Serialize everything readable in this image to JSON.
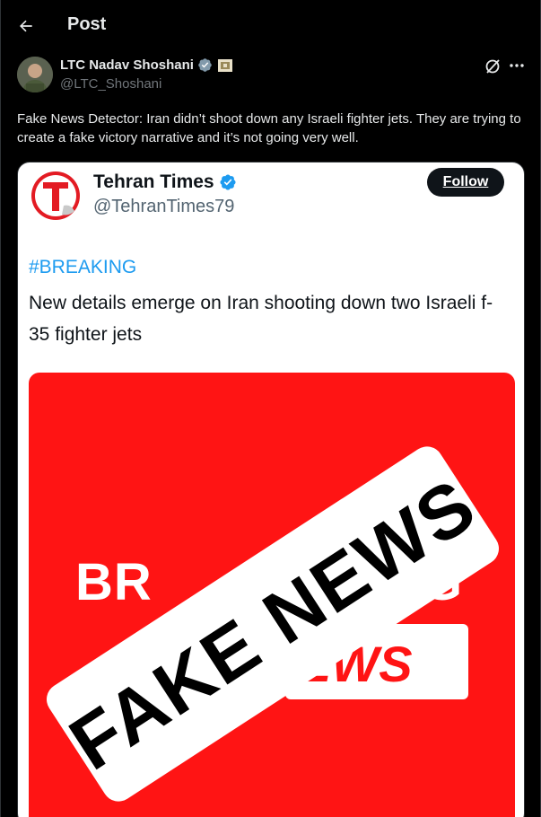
{
  "header": {
    "title": "Post"
  },
  "author": {
    "name": "LTC Nadav Shoshani",
    "handle": "@LTC_Shoshani"
  },
  "post": {
    "text": "Fake News Detector: Iran didn’t shoot down any Israeli fighter jets. They are trying to create a fake victory narrative and it’s not going very well."
  },
  "embedded": {
    "account_name": "Tehran Times",
    "account_handle": "@TehranTimes79",
    "follow_label": "Follow",
    "hashtag": "#BREAKING",
    "body": "New details emerge on Iran shooting down two Israeli f-35 fighter jets",
    "image": {
      "left_text": "BR",
      "right_text": "G",
      "news_text": "EWS",
      "stamp_text": "FAKE NEWS"
    }
  },
  "colors": {
    "background": "#000000",
    "verified_blue": "#1d9bf0",
    "alert_red": "#ff1414"
  },
  "icons": {
    "back": "arrow-left-icon",
    "verified": "verified-badge-icon",
    "affiliate": "affiliate-badge-icon",
    "grok": "grok-icon",
    "more": "more-icon",
    "logo": "tehran-times-logo"
  }
}
